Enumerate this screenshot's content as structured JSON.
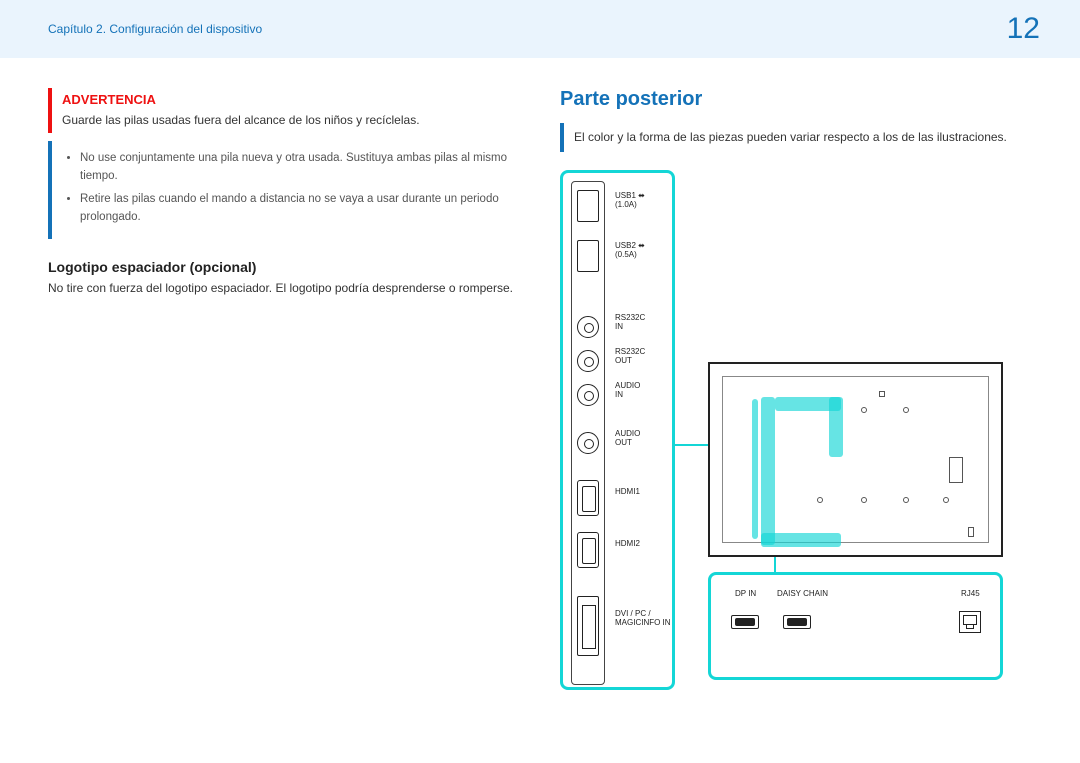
{
  "header": {
    "chapter": "Capítulo 2. Configuración del dispositivo",
    "page": "12"
  },
  "left": {
    "warning": {
      "title": "ADVERTENCIA",
      "text": "Guarde las pilas usadas fuera del alcance de los niños y recíclelas."
    },
    "notes": [
      "No use conjuntamente una pila nueva y otra usada. Sustituya ambas pilas al mismo tiempo.",
      "Retire las pilas cuando el mando a distancia no se vaya a usar durante un periodo prolongado."
    ],
    "subhead": "Logotipo espaciador (opcional)",
    "body": "No tire con fuerza del logotipo espaciador. El logotipo podría desprenderse o romperse."
  },
  "right": {
    "title": "Parte posterior",
    "info": "El color y la forma de las piezas pueden variar respecto a los de las ilustraciones.",
    "ports": {
      "usb1": "USB1 ⬌",
      "usb1_amp": "(1.0A)",
      "usb2": "USB2 ⬌",
      "usb2_amp": "(0.5A)",
      "rs_in": "RS232C",
      "rs_in2": "IN",
      "rs_out": "RS232C",
      "rs_out2": "OUT",
      "audio_in": "AUDIO",
      "audio_in2": "IN",
      "audio_out": "AUDIO",
      "audio_out2": "OUT",
      "hdmi1": "HDMI1",
      "hdmi2": "HDMI2",
      "dvi": "DVI / PC /",
      "dvi2": "MAGICINFO IN"
    },
    "bottom": {
      "dp": "DP IN",
      "daisy": "DAISY CHAIN",
      "rj45": "RJ45"
    }
  }
}
